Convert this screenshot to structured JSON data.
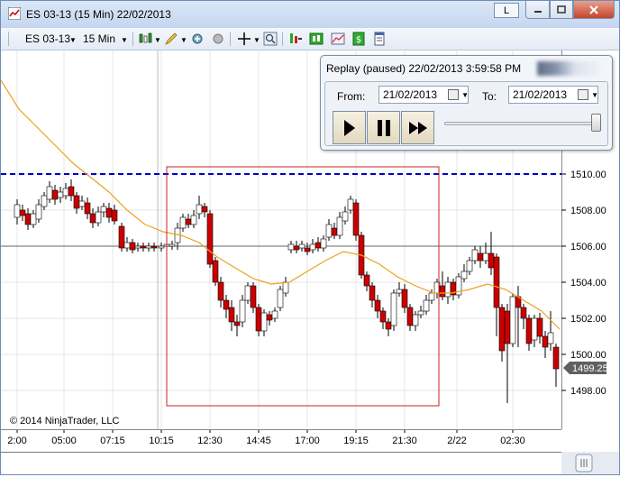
{
  "window": {
    "title": "ES 03-13 (15 Min)  22/02/2013",
    "l_button": "L"
  },
  "toolbar": {
    "instrument": "ES 03-13",
    "interval": "15 Min"
  },
  "chart": {
    "copyright": "© 2014 NinjaTrader, LLC",
    "current_price": "1499.25",
    "y_ticks": [
      "1510.00",
      "1508.00",
      "1506.00",
      "1504.00",
      "1502.00",
      "1500.00",
      "1498.00"
    ],
    "x_ticks": [
      "2:00",
      "05:00",
      "07:15",
      "10:15",
      "12:30",
      "14:45",
      "17:00",
      "19:15",
      "21:30",
      "2/22",
      "02:30"
    ],
    "colors": {
      "up": "#ffffff",
      "down": "#cc0000",
      "sma": "#f0a020",
      "dashed": "#0000cc",
      "highlight": "#cc2222"
    }
  },
  "replay": {
    "title": "Replay (paused) 22/02/2013 3:59:58 PM",
    "from_label": "From:",
    "to_label": "To:",
    "from_date": "21/02/2013",
    "to_date": "21/02/2013"
  }
}
